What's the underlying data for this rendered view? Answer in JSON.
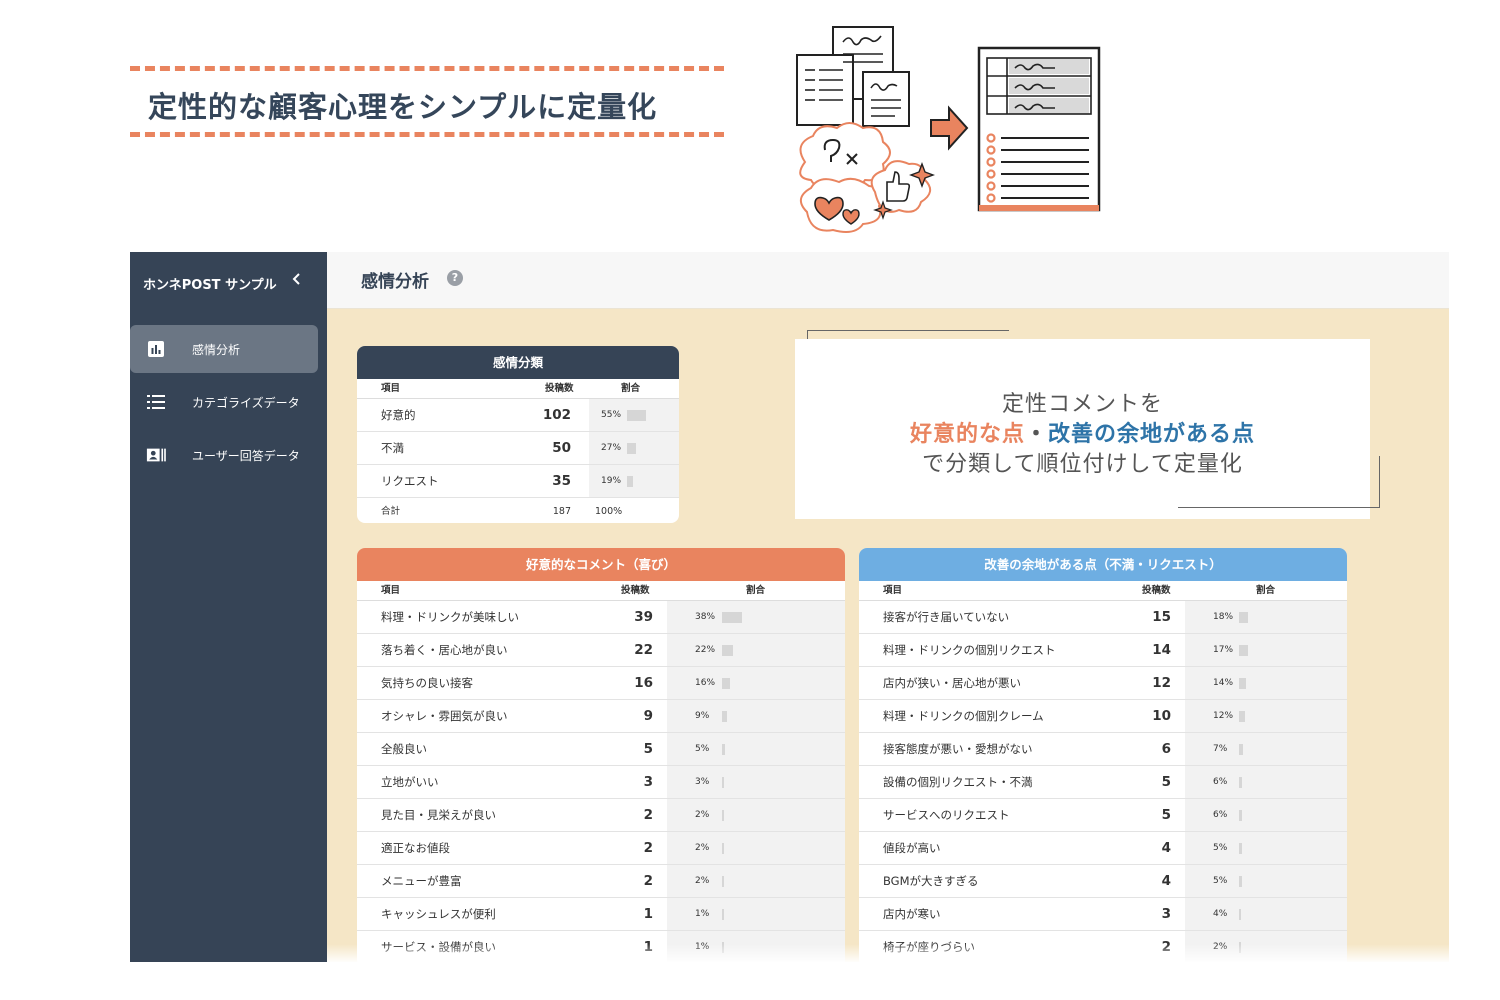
{
  "headline": "定性的な顧客心理をシンプルに定量化",
  "sidebar": {
    "brand": "ホンネPOST サンプル",
    "collapse_icon": "chevron-left-icon",
    "items": [
      {
        "label": "感情分析",
        "icon": "bar-chart-icon",
        "active": true
      },
      {
        "label": "カテゴライズデータ",
        "icon": "list-icon",
        "active": false
      },
      {
        "label": "ユーザー回答データ",
        "icon": "user-card-icon",
        "active": false
      }
    ]
  },
  "header": {
    "title": "感情分析",
    "help_icon": "?"
  },
  "summary": {
    "title": "感情分類",
    "columns": {
      "item": "項目",
      "count": "投稿数",
      "ratio": "割合"
    },
    "rows": [
      {
        "label": "好意的",
        "count": "102",
        "pct": "55%",
        "ratio": 0.55
      },
      {
        "label": "不満",
        "count": "50",
        "pct": "27%",
        "ratio": 0.27
      },
      {
        "label": "リクエスト",
        "count": "35",
        "pct": "19%",
        "ratio": 0.19
      }
    ],
    "total": {
      "label": "合計",
      "count": "187",
      "pct": "100%"
    }
  },
  "callout": {
    "line1": "定性コメントを",
    "line2_orange": "好意的な点",
    "line2_sep": "・",
    "line2_blue": "改善の余地がある点",
    "line3": "で分類して順位付けして定量化"
  },
  "positive": {
    "title": "好意的なコメント（喜び）",
    "columns": {
      "item": "項目",
      "count": "投稿数",
      "ratio": "割合"
    },
    "rows": [
      {
        "label": "料理・ドリンクが美味しい",
        "count": "39",
        "pct": "38%",
        "ratio": 0.38
      },
      {
        "label": "落ち着く・居心地が良い",
        "count": "22",
        "pct": "22%",
        "ratio": 0.22
      },
      {
        "label": "気持ちの良い接客",
        "count": "16",
        "pct": "16%",
        "ratio": 0.16
      },
      {
        "label": "オシャレ・雰囲気が良い",
        "count": "9",
        "pct": "9%",
        "ratio": 0.09
      },
      {
        "label": "全般良い",
        "count": "5",
        "pct": "5%",
        "ratio": 0.05
      },
      {
        "label": "立地がいい",
        "count": "3",
        "pct": "3%",
        "ratio": 0.03
      },
      {
        "label": "見た目・見栄えが良い",
        "count": "2",
        "pct": "2%",
        "ratio": 0.02
      },
      {
        "label": "適正なお値段",
        "count": "2",
        "pct": "2%",
        "ratio": 0.02
      },
      {
        "label": "メニューが豊富",
        "count": "2",
        "pct": "2%",
        "ratio": 0.02
      },
      {
        "label": "キャッシュレスが便利",
        "count": "1",
        "pct": "1%",
        "ratio": 0.01
      },
      {
        "label": "サービス・設備が良い",
        "count": "1",
        "pct": "1%",
        "ratio": 0.01
      }
    ]
  },
  "negative": {
    "title": "改善の余地がある点（不満・リクエスト）",
    "columns": {
      "item": "項目",
      "count": "投稿数",
      "ratio": "割合"
    },
    "rows": [
      {
        "label": "接客が行き届いていない",
        "count": "15",
        "pct": "18%",
        "ratio": 0.18
      },
      {
        "label": "料理・ドリンクの個別リクエスト",
        "count": "14",
        "pct": "17%",
        "ratio": 0.17
      },
      {
        "label": "店内が狭い・居心地が悪い",
        "count": "12",
        "pct": "14%",
        "ratio": 0.14
      },
      {
        "label": "料理・ドリンクの個別クレーム",
        "count": "10",
        "pct": "12%",
        "ratio": 0.12
      },
      {
        "label": "接客態度が悪い・愛想がない",
        "count": "6",
        "pct": "7%",
        "ratio": 0.07
      },
      {
        "label": "設備の個別リクエスト・不満",
        "count": "5",
        "pct": "6%",
        "ratio": 0.06
      },
      {
        "label": "サービスへのリクエスト",
        "count": "5",
        "pct": "6%",
        "ratio": 0.06
      },
      {
        "label": "値段が高い",
        "count": "4",
        "pct": "5%",
        "ratio": 0.05
      },
      {
        "label": "BGMが大きすぎる",
        "count": "4",
        "pct": "5%",
        "ratio": 0.05
      },
      {
        "label": "店内が寒い",
        "count": "3",
        "pct": "4%",
        "ratio": 0.04
      },
      {
        "label": "椅子が座りづらい",
        "count": "2",
        "pct": "2%",
        "ratio": 0.02
      }
    ]
  },
  "colors": {
    "accent_orange": "#e9845f",
    "accent_blue": "#6eaee2",
    "navy": "#364456",
    "cream": "#f5e6c6"
  }
}
